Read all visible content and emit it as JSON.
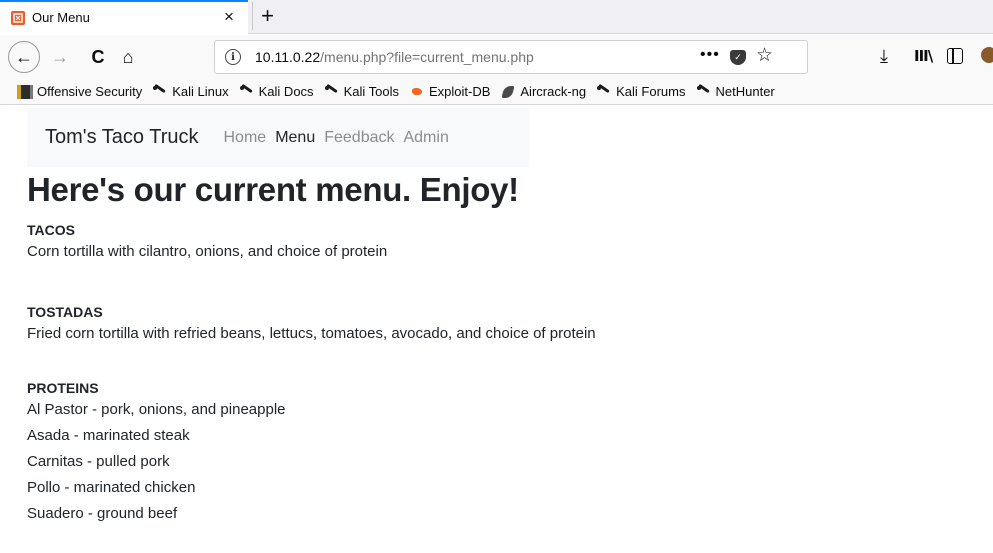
{
  "browser": {
    "tab_title": "Our Menu",
    "tab_close": "×",
    "new_tab": "+",
    "back": "←",
    "forward": "→",
    "reload": "C",
    "home": "⌂",
    "url_host": "10.11.0.22",
    "url_path": "/menu.php?file=current_menu.php",
    "url_more": "•••",
    "star": "☆",
    "download": "⤓",
    "library": "III\\",
    "info": "i",
    "accent_color": "#0a84ff",
    "favicon_color": "#f05a24"
  },
  "bookmarks": [
    {
      "label": "Offensive Security",
      "icon": "offsec-icon"
    },
    {
      "label": "Kali Linux",
      "icon": "kali-dragon-icon"
    },
    {
      "label": "Kali Docs",
      "icon": "kali-dragon-icon"
    },
    {
      "label": "Kali Tools",
      "icon": "kali-dragon-icon"
    },
    {
      "label": "Exploit-DB",
      "icon": "exploitdb-icon"
    },
    {
      "label": "Aircrack-ng",
      "icon": "aircrack-icon"
    },
    {
      "label": "Kali Forums",
      "icon": "kali-dragon-icon"
    },
    {
      "label": "NetHunter",
      "icon": "kali-dragon-icon"
    }
  ],
  "site": {
    "brand": "Tom's Taco Truck",
    "nav": [
      {
        "label": "Home",
        "active": false
      },
      {
        "label": "Menu",
        "active": true
      },
      {
        "label": "Feedback",
        "active": false
      },
      {
        "label": "Admin",
        "active": false
      }
    ]
  },
  "page": {
    "heading": "Here's our current menu. Enjoy!",
    "tacos": {
      "title": "TACOS",
      "description": "Corn tortilla with cilantro, onions, and choice of protein"
    },
    "tostadas": {
      "title": "TOSTADAS",
      "description": "Fried corn tortilla with refried beans, lettucs, tomatoes, avocado, and choice of protein"
    },
    "proteins": {
      "title": "PROTEINS",
      "items": [
        "Al Pastor - pork, onions, and pineapple",
        "Asada - marinated steak",
        "Carnitas - pulled pork",
        "Pollo - marinated chicken",
        "Suadero - ground beef"
      ]
    }
  }
}
